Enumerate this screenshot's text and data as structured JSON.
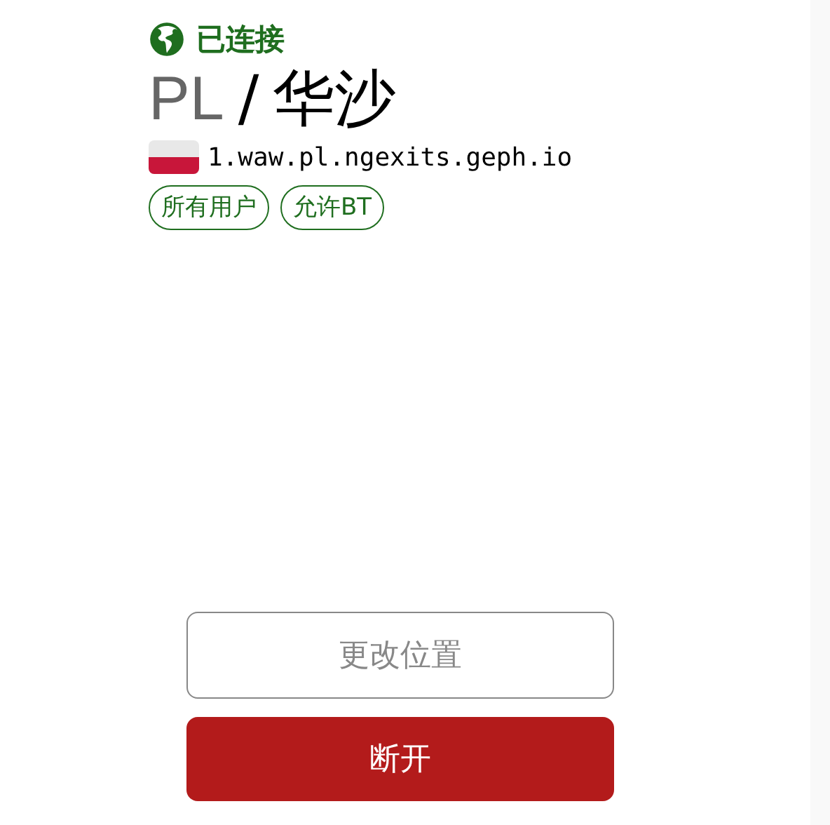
{
  "status": {
    "text": "已连接",
    "connected": true
  },
  "location": {
    "country": "PL",
    "separator": "/",
    "city": "华沙"
  },
  "server": {
    "host": "1.waw.pl.ngexits.geph.io"
  },
  "tags": [
    "所有用户",
    "允许BT"
  ],
  "buttons": [
    {
      "label": "更改位置",
      "kind": "outline"
    },
    {
      "label": "断开",
      "kind": "danger"
    }
  ]
}
